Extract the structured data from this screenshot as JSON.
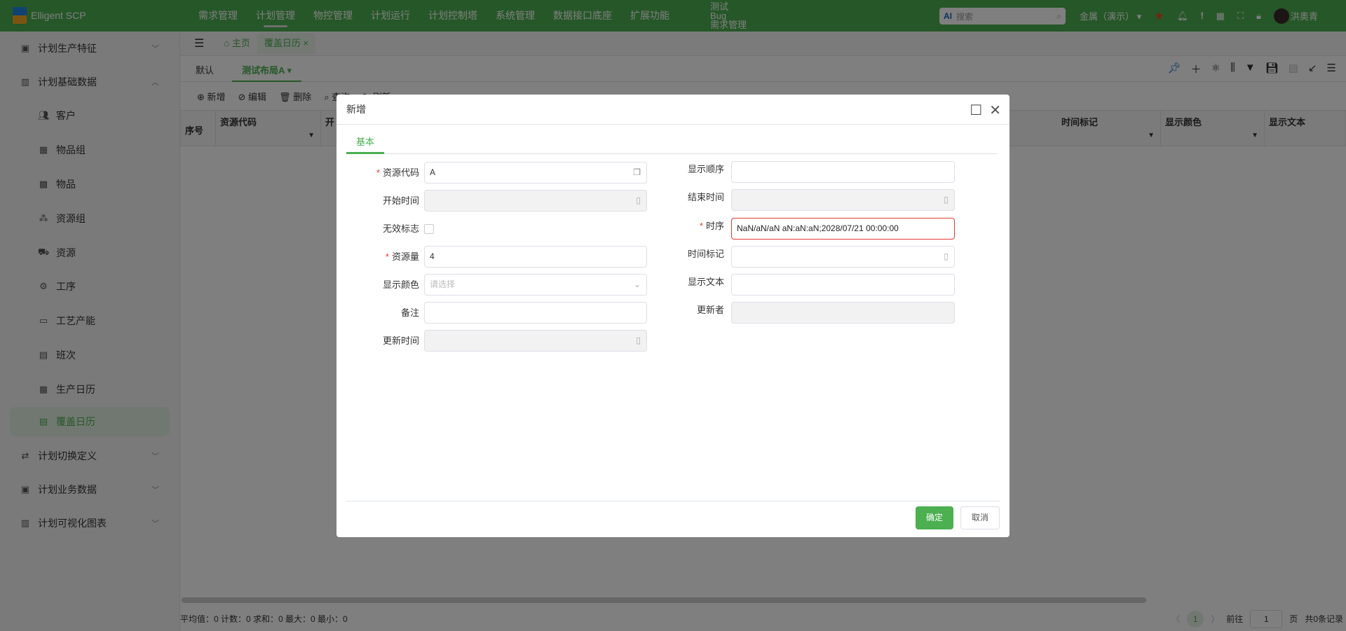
{
  "app": {
    "title": "Elligent SCP"
  },
  "nav": [
    "需求管理",
    "计划管理",
    "物控管理",
    "计划运行",
    "计划控制塔",
    "系统管理",
    "数据接口底座",
    "扩展功能"
  ],
  "nav_multi": [
    "测试",
    "Bug",
    "需求管理"
  ],
  "search": {
    "placeholder": "搜索",
    "ai": "AI"
  },
  "tenant": "金属（演示）",
  "user": "洪奥青",
  "sidebar": {
    "groups": [
      {
        "label": "计划生产特征"
      },
      {
        "label": "计划基础数据"
      },
      {
        "label": "计划切换定义"
      },
      {
        "label": "计划业务数据"
      },
      {
        "label": "计划可视化图表"
      }
    ],
    "items": [
      "客户",
      "物品组",
      "物品",
      "资源组",
      "资源",
      "工序",
      "工艺产能",
      "班次",
      "生产日历",
      "覆盖日历"
    ]
  },
  "tabs": {
    "home": "主页",
    "current": "覆盖日历"
  },
  "layout_tabs": [
    "默认",
    "测试布局A"
  ],
  "toolbar": [
    "新增",
    "编辑",
    "删除",
    "查询",
    "刷新"
  ],
  "table": {
    "columns": [
      "序号",
      "资源代码",
      "开",
      "时间标记",
      "显示颜色",
      "显示文本"
    ]
  },
  "status": {
    "summary": "平均值：0 计数：0 求和：0 最大：0 最小：0",
    "goto": "前往",
    "page": "1",
    "page_unit": "页",
    "total": "共0条记录",
    "current_page": "1"
  },
  "modal": {
    "title": "新增",
    "tab": "基本",
    "left": [
      {
        "label": "资源代码",
        "value": "A",
        "required": true
      },
      {
        "label": "开始时间",
        "value": ""
      },
      {
        "label": "无效标志",
        "value": ""
      },
      {
        "label": "资源量",
        "value": "4",
        "required": true
      },
      {
        "label": "显示颜色",
        "placeholder": "请选择"
      },
      {
        "label": "备注",
        "value": ""
      },
      {
        "label": "更新时间",
        "value": ""
      }
    ],
    "right": [
      {
        "label": "显示顺序",
        "value": ""
      },
      {
        "label": "结束时间",
        "value": ""
      },
      {
        "label": "时序",
        "value": "NaN/aN/aN aN:aN:aN;2028/07/21 00:00:00",
        "required": true
      },
      {
        "label": "时间标记",
        "value": ""
      },
      {
        "label": "显示文本",
        "value": ""
      },
      {
        "label": "更新者",
        "value": ""
      }
    ],
    "ok": "确定",
    "cancel": "取消"
  }
}
